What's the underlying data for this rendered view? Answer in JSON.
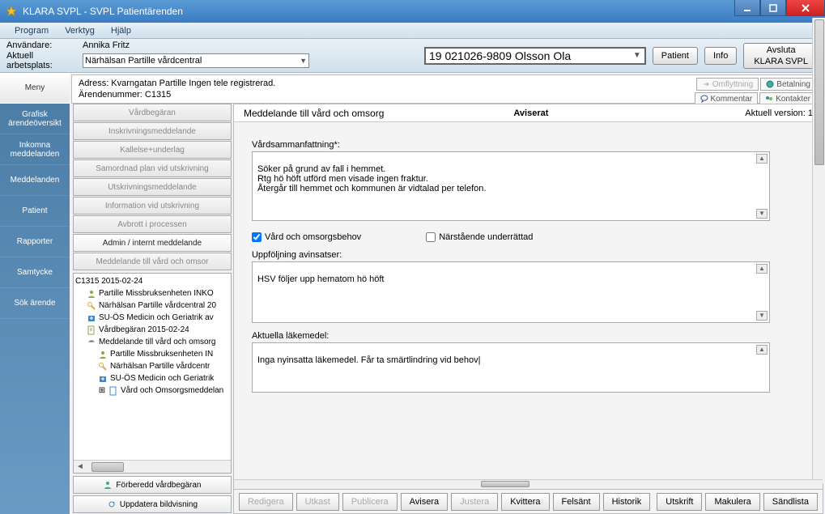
{
  "window": {
    "title": "KLARA SVPL - SVPL Patientärenden"
  },
  "menubar": {
    "program": "Program",
    "verktyg": "Verktyg",
    "hjalp": "Hjälp"
  },
  "infobar": {
    "user_label": "Användare:",
    "user_value": "Annika Fritz",
    "workplace_label": "Aktuell arbetsplats:",
    "workplace_value": "Närhälsan Partille vårdcentral",
    "patient_value": "19 021026-9809 Olsson Ola",
    "patient_btn": "Patient",
    "info_btn": "Info",
    "exit_btn": "Avsluta\nKLARA SVPL"
  },
  "sidebar": {
    "items": [
      "Meny",
      "Grafisk\närendeöversikt",
      "Inkomna\nmeddelanden",
      "Meddelanden",
      "Patient",
      "Rapporter",
      "Samtycke",
      "Sök ärende"
    ]
  },
  "address": {
    "line1": "Adress: Kvarngatan   Partille  Ingen tele registrerad.",
    "line2": "Ärendenummer: C1315",
    "links": {
      "omflyttning": "Omflyttning",
      "betalning": "Betalning",
      "kommentar": "Kommentar",
      "kontakter": "Kontakter"
    }
  },
  "docnav": {
    "items": [
      "Vårdbegäran",
      "Inskrivningsmeddelande",
      "Kallelse+underlag",
      "Samordnad plan vid utskrivning",
      "Utskrivningsmeddelande",
      "Information vid utskrivning",
      "Avbrott i processen",
      "Admin / internt meddelande",
      "Meddelande till vård och omsor"
    ]
  },
  "tree": {
    "root": "C1315 2015-02-24",
    "rows": [
      "Partille Missbruksenheten INKO",
      "Närhälsan Partille vårdcentral 20",
      "SU-ÖS Medicin och Geriatrik av",
      "Vårdbegäran 2015-02-24",
      "Meddelande till vård och omsorg"
    ],
    "sub": [
      "Partille Missbruksenheten IN",
      "Närhälsan Partille vårdcentr",
      "SU-ÖS Medicin och Geriatrik",
      "Vård och Omsorgsmeddelan"
    ]
  },
  "navbottom": {
    "forberedd": "Förberedd vårdbegäran",
    "uppdatera": "Uppdatera bildvisning"
  },
  "form": {
    "title": "Meddelande till vård och omsorg",
    "status": "Aviserat",
    "version": "Aktuell version: 1",
    "sec1_label": "Vårdsammanfattning*:",
    "sec1_text": "Söker på grund av fall i hemmet.\nRtg hö höft utförd men visade ingen fraktur.\nÅtergår till hemmet och kommunen är vidtalad per telefon.",
    "check1": "Vård och omsorgsbehov",
    "check2": "Närstående underrättad",
    "sec2_label": "Uppföljning avinsatser:",
    "sec2_text": "HSV följer upp hematom hö höft",
    "sec3_label": "Aktuella läkemedel:",
    "sec3_text": "Inga nyinsatta läkemedel. Får ta smärtlindring vid behov|"
  },
  "bottombar": {
    "redigera": "Redigera",
    "utkast": "Utkast",
    "publicera": "Publicera",
    "avisera": "Avisera",
    "justera": "Justera",
    "kvittera": "Kvittera",
    "felsant": "Felsänt",
    "historik": "Historik",
    "utskrift": "Utskrift",
    "makulera": "Makulera",
    "sandlista": "Sändlista"
  }
}
